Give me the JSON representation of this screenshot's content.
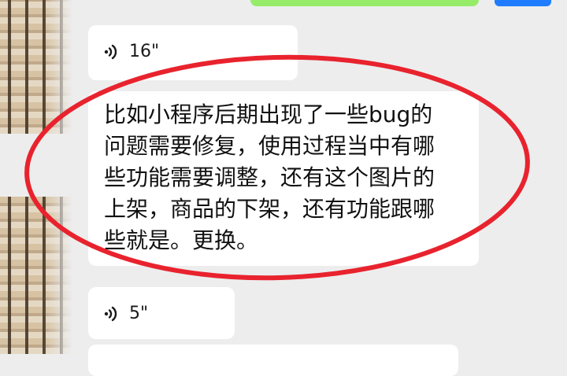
{
  "messages": [
    {
      "type": "voice",
      "duration": "16\"",
      "icon": "voice-wave-icon"
    },
    {
      "type": "text",
      "lines": [
        "比如小程序后期出现了一些bug的",
        "问题需要修复，使用过程当中有哪",
        "些功能需要调整，还有这个图片的",
        "上架，商品的下架，还有功能跟哪",
        "些就是。更换。"
      ]
    },
    {
      "type": "voice",
      "duration": "5\"",
      "icon": "voice-wave-icon"
    }
  ],
  "colors": {
    "chat_background": "#ededed",
    "bubble": "#ffffff",
    "outgoing_bubble": "#95ec69",
    "accent_blue": "#1f7cff",
    "highlight_circle": "#e8232e"
  }
}
